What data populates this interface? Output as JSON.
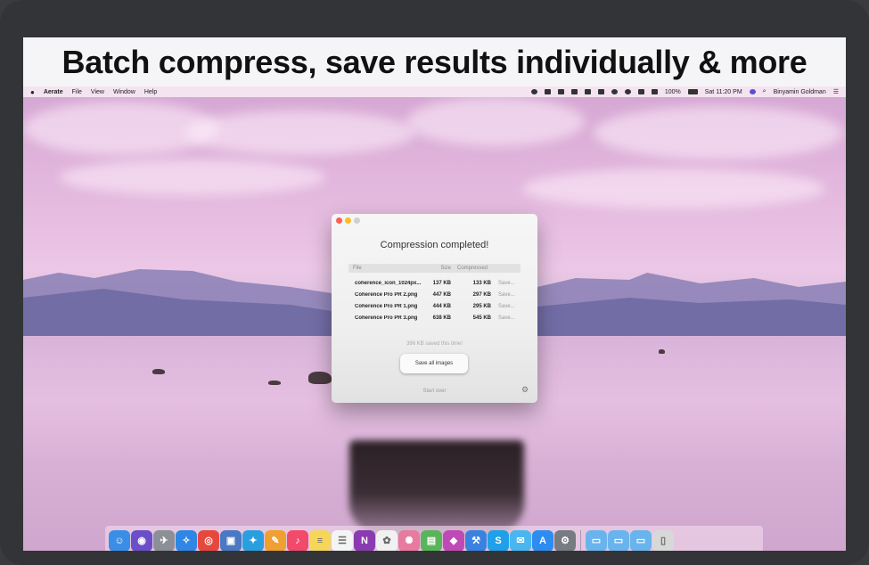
{
  "banner": {
    "title": "Batch compress, save results individually & more"
  },
  "menubar": {
    "apple": "",
    "app_name": "Aerate",
    "menus": [
      "File",
      "View",
      "Window",
      "Help"
    ],
    "battery": "100%",
    "clock": "Sat 11:20 PM",
    "user": "Binyamin Goldman"
  },
  "window": {
    "title": "Compression completed!",
    "columns": {
      "file": "File",
      "size": "Size",
      "compressed": "Compressed"
    },
    "rows": [
      {
        "file": "coherence_icon_1024px...",
        "size": "137 KB",
        "compressed": "133 KB",
        "action": "Save..."
      },
      {
        "file": "Coherence Pro PR 2.png",
        "size": "447 KB",
        "compressed": "297 KB",
        "action": "Save..."
      },
      {
        "file": "Coherence Pro PR 1.png",
        "size": "444 KB",
        "compressed": "295 KB",
        "action": "Save..."
      },
      {
        "file": "Coherence Pro PR 3.png",
        "size": "638 KB",
        "compressed": "545 KB",
        "action": "Save..."
      }
    ],
    "saved_text": "396 KB saved this time!",
    "save_all_label": "Save all images",
    "start_over_label": "Start over"
  },
  "dock": {
    "items": [
      {
        "name": "finder-icon",
        "color": "#3a8ee6",
        "glyph": "☺"
      },
      {
        "name": "siri-icon",
        "color": "#6b4fc9",
        "glyph": "◉"
      },
      {
        "name": "launchpad-icon",
        "color": "#8b8f96",
        "glyph": "✈"
      },
      {
        "name": "safari-icon",
        "color": "#2f86e4",
        "glyph": "✧"
      },
      {
        "name": "chrome-icon",
        "color": "#e6483d",
        "glyph": "◎"
      },
      {
        "name": "photos-app-icon",
        "color": "#4a78c2",
        "glyph": "▣"
      },
      {
        "name": "tweetbot-icon",
        "color": "#2a9fe0",
        "glyph": "✦"
      },
      {
        "name": "pages-icon",
        "color": "#f0a030",
        "glyph": "✎"
      },
      {
        "name": "music-icon",
        "color": "#f24a6a",
        "glyph": "♪"
      },
      {
        "name": "notes-icon",
        "color": "#f6d65a",
        "glyph": "≡"
      },
      {
        "name": "reminders-icon",
        "color": "#f4f4f4",
        "glyph": "☰"
      },
      {
        "name": "onenote-icon",
        "color": "#8a3bb0",
        "glyph": "N"
      },
      {
        "name": "photos-icon",
        "color": "#f1f1f1",
        "glyph": "✿"
      },
      {
        "name": "pinwheel-icon",
        "color": "#e87aa0",
        "glyph": "✺"
      },
      {
        "name": "preview-icon",
        "color": "#5ab45a",
        "glyph": "▤"
      },
      {
        "name": "sketch-icon",
        "color": "#c04ab5",
        "glyph": "◆"
      },
      {
        "name": "xcode-icon",
        "color": "#3a82e0",
        "glyph": "⚒"
      },
      {
        "name": "skype-icon",
        "color": "#1fa0e8",
        "glyph": "S"
      },
      {
        "name": "messages-icon",
        "color": "#4ab6f0",
        "glyph": "✉"
      },
      {
        "name": "app-store-icon",
        "color": "#2d8cf0",
        "glyph": "A"
      },
      {
        "name": "system-preferences-icon",
        "color": "#777b82",
        "glyph": "⚙"
      },
      {
        "name": "applications-folder-icon",
        "color": "#6ab4ee",
        "glyph": "▭"
      },
      {
        "name": "documents-folder-icon",
        "color": "#6ab4ee",
        "glyph": "▭"
      },
      {
        "name": "downloads-folder-icon",
        "color": "#6ab4ee",
        "glyph": "▭"
      },
      {
        "name": "trash-icon",
        "color": "#d8d8d8",
        "glyph": "▯"
      }
    ]
  }
}
